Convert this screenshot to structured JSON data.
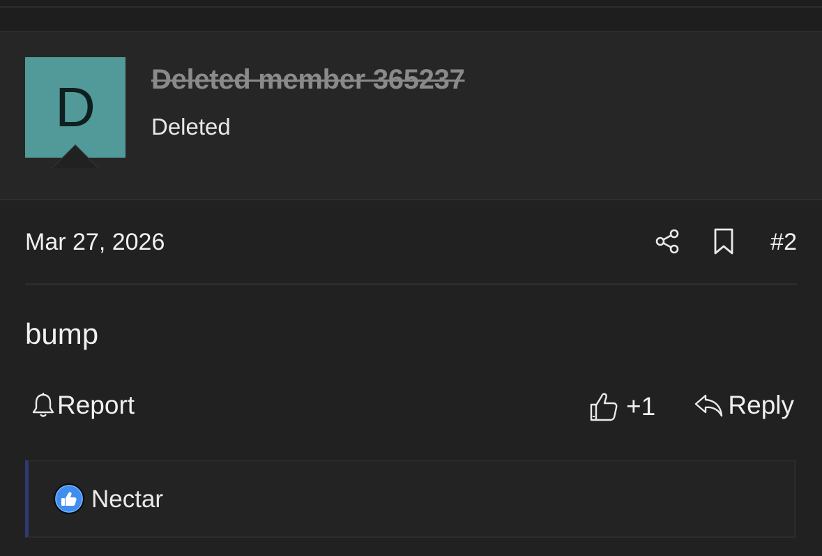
{
  "user": {
    "avatar_letter": "D",
    "avatar_color": "#519a99",
    "name": "Deleted member 365237",
    "title": "Deleted"
  },
  "post": {
    "date": "Mar 27, 2026",
    "number": "#2",
    "body": "bump",
    "icons": [
      "share-icon",
      "bookmark-icon"
    ]
  },
  "actions": {
    "report_label": "Report",
    "like_label": "+1",
    "reply_label": "Reply"
  },
  "reactions": {
    "users": "Nectar",
    "icon": "thumbs-up-reaction-icon",
    "accent_color": "#2e3a70"
  }
}
